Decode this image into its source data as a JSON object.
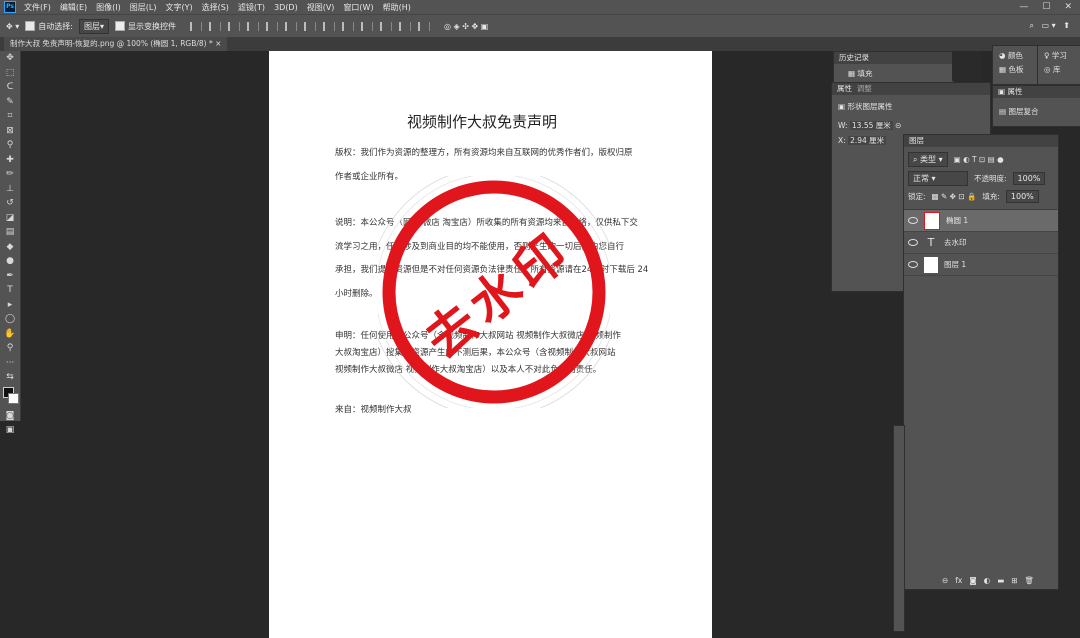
{
  "app": {
    "logo": "Ps"
  },
  "menu": [
    "文件(F)",
    "编辑(E)",
    "图像(I)",
    "图层(L)",
    "文字(Y)",
    "选择(S)",
    "滤镜(T)",
    "3D(D)",
    "视图(V)",
    "窗口(W)",
    "帮助(H)"
  ],
  "options": {
    "auto_select_label": "自动选择:",
    "auto_select_value": "图层",
    "show_transform_label": "显示变换控件"
  },
  "document_tab": "制作大叔 免责声明-恢复的.png @ 100% (椭圆 1, RGB/8) *",
  "document": {
    "title": "视频制作大叔免责声明",
    "p1_line1": "版权：我们作为资源的整理方，所有资源均来自互联网的优秀作者们，版权归原",
    "p1_line2": "作者或企业所有。",
    "p2_line1": "说明：本公众号（网站 微店 淘宝店）所收集的所有资源均来自网络，仅供私下交",
    "p2_line2": "流学习之用，任何涉及到商业目的均不能使用，否则产生的一切后果由您自行",
    "p2_line3": "承担，我们提供资源但是不对任何资源负法律责任，所有资源请在24小时下载后 24",
    "p2_line4": "小时删除。",
    "p3_line1": "申明：任何使用本公众号（含视频制作大叔网站 视频制作大叔微店 视频制作",
    "p3_line2": "大叔淘宝店）搜集的资源产生的不测后果，本公众号（含视频制作大叔网站",
    "p3_line3": "视频制作大叔微店 视频制作大叔淘宝店）以及本人不对此负任何责任。",
    "source": "来自：视频制作大叔",
    "stamp_text": "去水印"
  },
  "history_panel": {
    "tab": "历史记录",
    "item": "填充"
  },
  "color_panel": {
    "tab1": "颜色",
    "tab2": "色板"
  },
  "learn_panel": {
    "tab1": "学习",
    "tab2": "库"
  },
  "properties_panel": {
    "tab1": "属性",
    "tab2": "调整",
    "subtitle": "形状图层属性",
    "w_label": "W:",
    "w_value": "13.55 厘米",
    "x_label": "X:",
    "x_value": "2.94 厘米"
  },
  "adjust_panel": {
    "tab1": "属性",
    "tab2": "图层复合"
  },
  "layers_panel": {
    "tab": "图层",
    "filter": "类型",
    "blend": "正常",
    "opacity_label": "不透明度:",
    "opacity": "100%",
    "lock_label": "锁定:",
    "fill_label": "填充:",
    "fill": "100%",
    "layers": [
      "椭圆 1",
      "去水印",
      "图层 1"
    ]
  },
  "colors": {
    "stamp_red": "#e0161c",
    "ui_bg": "#535353",
    "canvas_bg": "#282828"
  }
}
